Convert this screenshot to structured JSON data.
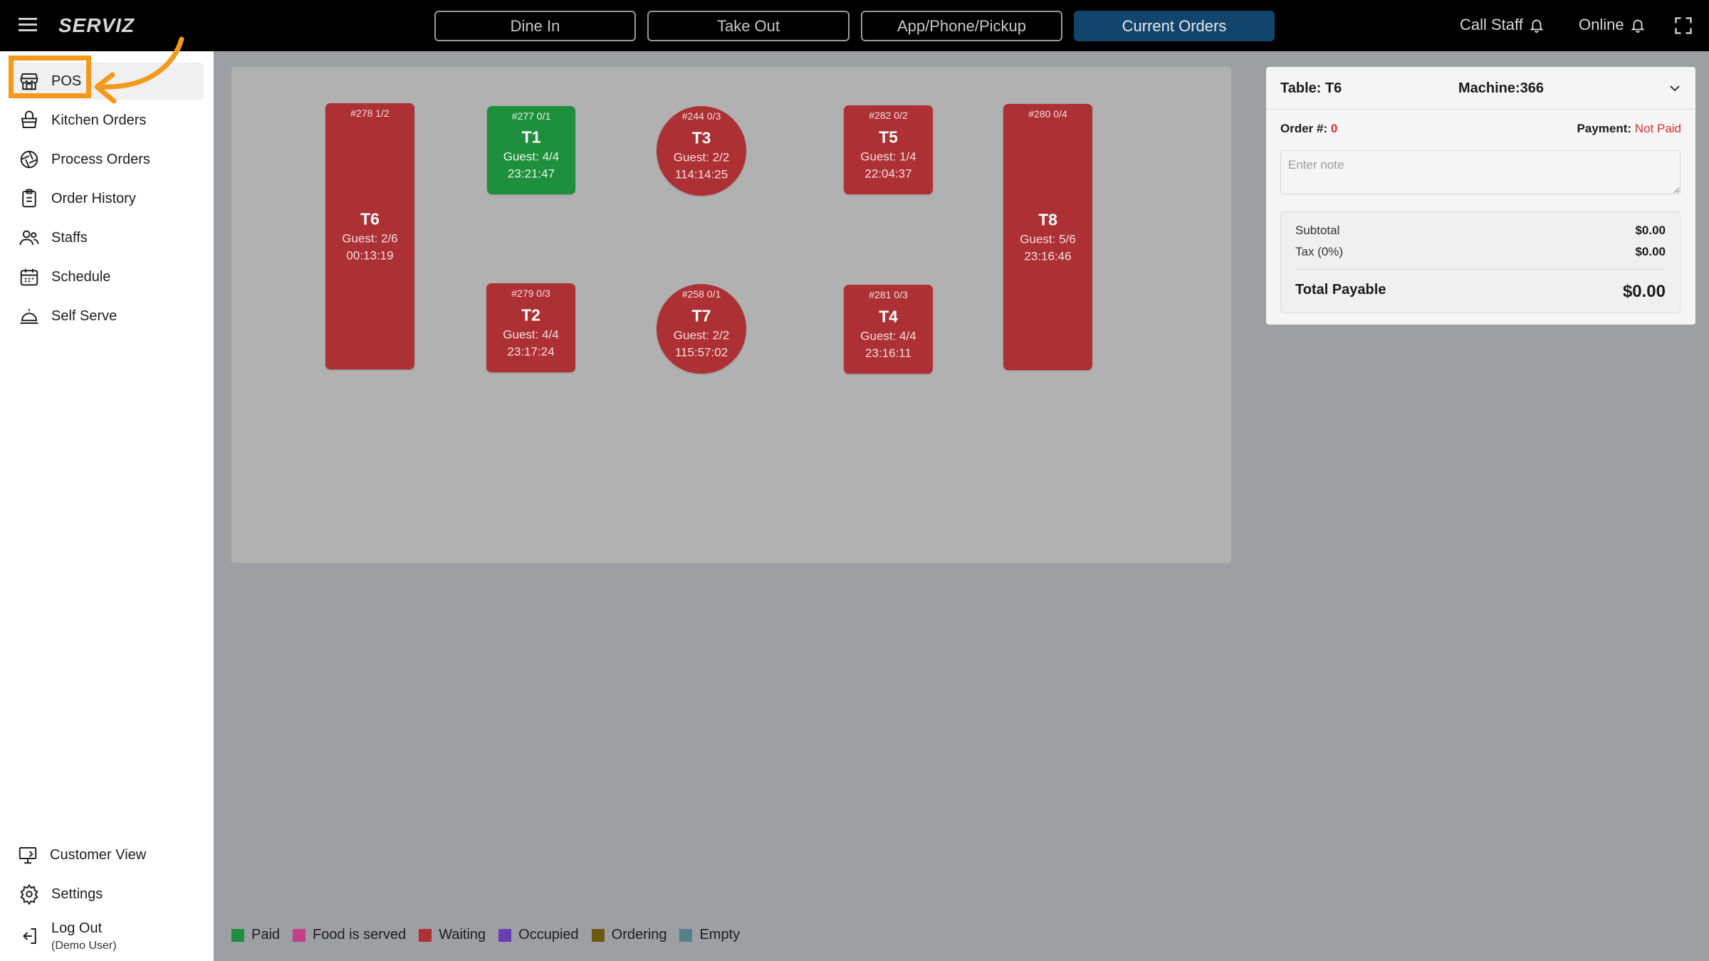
{
  "app": {
    "logo": "SERVIZ"
  },
  "header": {
    "tabs": [
      {
        "label": "Dine In"
      },
      {
        "label": "Take Out"
      },
      {
        "label": "App/Phone/Pickup"
      },
      {
        "label": "Current Orders",
        "active": true
      }
    ],
    "call_staff": "Call Staff",
    "online": "Online"
  },
  "sidebar": {
    "items": [
      {
        "label": "POS",
        "icon": "store-icon",
        "active": true
      },
      {
        "label": "Kitchen Orders",
        "icon": "basket-icon"
      },
      {
        "label": "Process Orders",
        "icon": "aperture-icon"
      },
      {
        "label": "Order History",
        "icon": "clipboard-icon"
      },
      {
        "label": "Staffs",
        "icon": "users-icon"
      },
      {
        "label": "Schedule",
        "icon": "calendar-icon"
      },
      {
        "label": "Self Serve",
        "icon": "service-bell-icon"
      }
    ],
    "bottom": {
      "customer_view": "Customer View",
      "settings": "Settings",
      "logout": "Log Out",
      "logout_user": "(Demo User)"
    }
  },
  "tables": [
    {
      "name": "T6",
      "order": "#278  1/2",
      "guest": "Guest: 2/6",
      "time": "00:13:19",
      "status": "Waiting"
    },
    {
      "name": "T1",
      "order": "#277  0/1",
      "guest": "Guest: 4/4",
      "time": "23:21:47",
      "status": "Paid"
    },
    {
      "name": "T3",
      "order": "#244  0/3",
      "guest": "Guest: 2/2",
      "time": "114:14:25",
      "status": "Waiting"
    },
    {
      "name": "T5",
      "order": "#282  0/2",
      "guest": "Guest: 1/4",
      "time": "22:04:37",
      "status": "Waiting"
    },
    {
      "name": "T8",
      "order": "#280  0/4",
      "guest": "Guest: 5/6",
      "time": "23:16:46",
      "status": "Waiting"
    },
    {
      "name": "T2",
      "order": "#279  0/3",
      "guest": "Guest: 4/4",
      "time": "23:17:24",
      "status": "Waiting"
    },
    {
      "name": "T7",
      "order": "#258  0/1",
      "guest": "Guest: 2/2",
      "time": "115:57:02",
      "status": "Waiting"
    },
    {
      "name": "T4",
      "order": "#281  0/3",
      "guest": "Guest: 4/4",
      "time": "23:16:11",
      "status": "Waiting"
    }
  ],
  "legend": [
    {
      "label": "Paid",
      "color": "#1e8f3d"
    },
    {
      "label": "Food is served",
      "color": "#c2408a"
    },
    {
      "label": "Waiting",
      "color": "#ad3034"
    },
    {
      "label": "Occupied",
      "color": "#6a3fb0"
    },
    {
      "label": "Ordering",
      "color": "#6b5a10"
    },
    {
      "label": "Empty",
      "color": "#557f8a"
    }
  ],
  "order_panel": {
    "table": "Table: T6",
    "machine": "Machine:366",
    "order_label": "Order #:",
    "order_value": "0",
    "payment_label": "Payment:",
    "payment_value": "Not Paid",
    "note_placeholder": "Enter note",
    "subtotal_label": "Subtotal",
    "subtotal_value": "$0.00",
    "tax_label": "Tax (0%)",
    "tax_value": "$0.00",
    "total_label": "Total Payable",
    "total_value": "$0.00"
  }
}
